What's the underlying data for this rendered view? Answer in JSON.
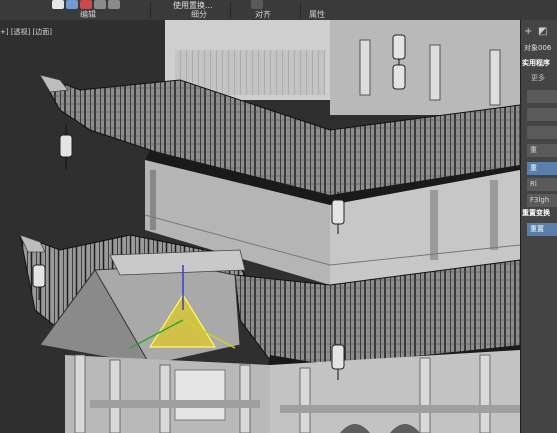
{
  "toolbar": {
    "groups": [
      {
        "label": "编辑"
      },
      {
        "label": "细分"
      },
      {
        "label": "对齐"
      },
      {
        "label": "属性"
      }
    ],
    "subdivide_button_label": "使用置换..."
  },
  "viewport": {
    "label": "+] [透视] [边面]"
  },
  "command_panel": {
    "object_name": "对象006",
    "rollout_title": "实用程序",
    "more_label": "更多",
    "buttons": [
      "重",
      "",
      "",
      "",
      "重",
      "Rl",
      "F3lgh"
    ],
    "rollout2_title": "重置变换",
    "reset_button": "重置"
  },
  "colors": {
    "accent": "#5b7fa8",
    "gizmo_x": "#d2d21e",
    "gizmo_y": "#2ea52e",
    "gizmo_z": "#3a3ad0",
    "selection": "#ffff5a"
  }
}
